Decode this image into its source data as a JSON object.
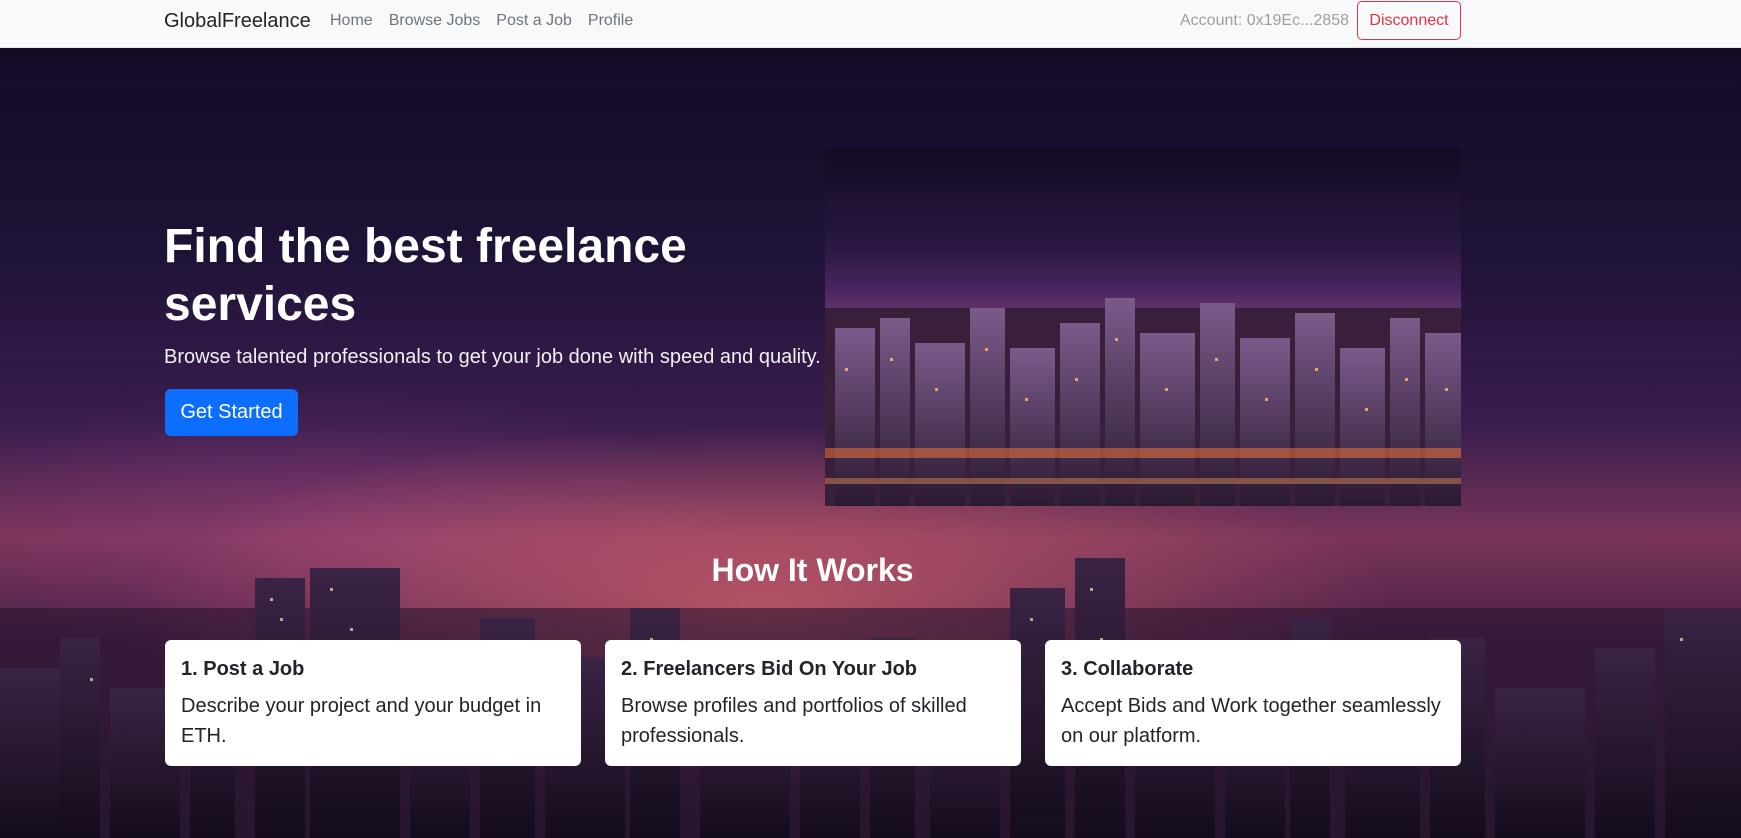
{
  "navbar": {
    "brand": "GlobalFreelance",
    "links": [
      "Home",
      "Browse Jobs",
      "Post a Job",
      "Profile"
    ],
    "account": "Account: 0x19Ec...2858",
    "disconnect_label": "Disconnect"
  },
  "hero": {
    "title": "Find the best freelance services",
    "subtitle": "Browse talented professionals to get your job done with speed and quality.",
    "cta_label": "Get Started"
  },
  "how_it_works": {
    "title": "How It Works",
    "steps": [
      {
        "title": "1. Post a Job",
        "text": "Describe your project and your budget in ETH."
      },
      {
        "title": "2. Freelancers Bid On Your Job",
        "text": "Browse profiles and portfolios of skilled professionals."
      },
      {
        "title": "3. Collaborate",
        "text": "Accept Bids and Work together seamlessly on our platform."
      }
    ]
  },
  "colors": {
    "primary": "#0d6efd",
    "danger": "#dc3545",
    "navbar_bg": "#f8f9fa"
  }
}
